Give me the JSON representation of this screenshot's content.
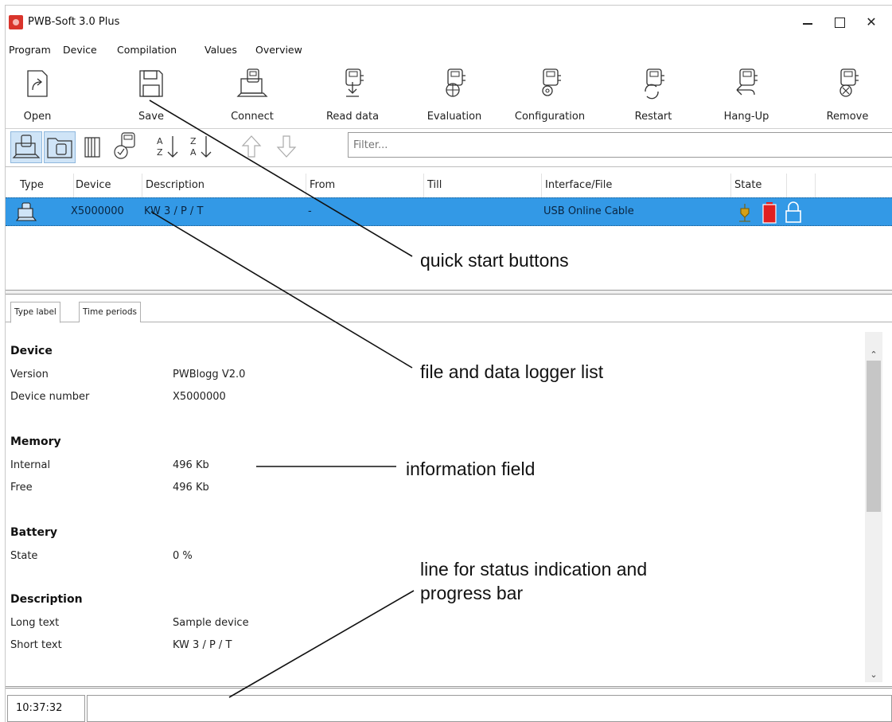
{
  "window": {
    "title": "PWB-Soft 3.0 Plus",
    "min_symbol": "",
    "max_symbol": "",
    "close_symbol": "✕"
  },
  "menu": [
    "Program",
    "Device",
    "Compilation",
    "Values",
    "Overview"
  ],
  "toolbar": {
    "open": "Open",
    "save": "Save",
    "connect": "Connect",
    "read_data": "Read data",
    "evaluation": "Evaluation",
    "configuration": "Configuration",
    "restart": "Restart",
    "hang_up": "Hang-Up",
    "remove": "Remove"
  },
  "filter": {
    "placeholder": "Filter..."
  },
  "table": {
    "headers": [
      "Type",
      "Device",
      "Description",
      "From",
      "Till",
      "Interface/File",
      "State"
    ],
    "rows": [
      {
        "type_icon": "pc-device-icon",
        "device": "X5000000",
        "description": "KW 3 / P / T",
        "from": "-",
        "till": "",
        "interface": "USB Online Cable",
        "state_icons": [
          "plug-icon",
          "battery-icon",
          "lock-icon"
        ]
      }
    ]
  },
  "tabs": [
    "Type label",
    "Time periods"
  ],
  "info": {
    "device_heading": "Device",
    "version_label": "Version",
    "version_value": "PWBlogg V2.0",
    "device_number_label": "Device number",
    "device_number_value": "X5000000",
    "memory_heading": "Memory",
    "internal_label": "Internal",
    "internal_value": "496 Kb",
    "free_label": "Free",
    "free_value": "496 Kb",
    "battery_heading": "Battery",
    "state_label": "State",
    "state_value": "0 %",
    "description_heading": "Description",
    "long_text_label": "Long text",
    "long_text_value": "Sample device",
    "short_text_label": "Short text",
    "short_text_value": "KW 3 / P / T"
  },
  "status": {
    "time": "10:37:32"
  },
  "annotations": {
    "quick_start": "quick start buttons",
    "file_list": "file and data logger list",
    "info_field": "information field",
    "status_line_1": "line for status indication and",
    "status_line_2": "progress bar"
  },
  "colors": {
    "selection": "#3399e6",
    "app_icon": "#d9342b",
    "battery": "#e02020",
    "plug": "#d4a017"
  }
}
